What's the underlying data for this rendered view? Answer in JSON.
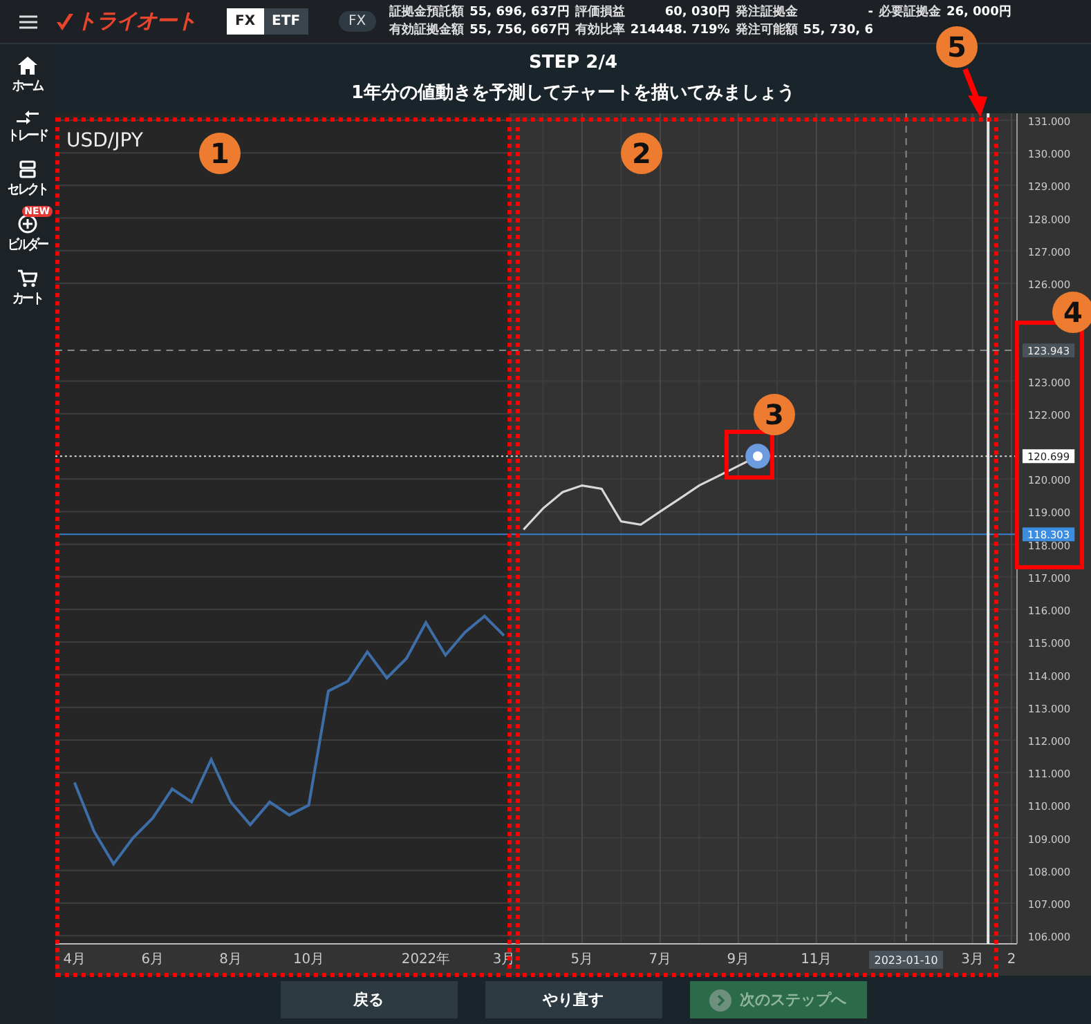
{
  "header": {
    "logo": "トライオート",
    "tabs": [
      {
        "label": "FX",
        "selected": true
      },
      {
        "label": "ETF",
        "selected": false
      }
    ],
    "market_badge": "FX",
    "stats": [
      {
        "label": "証拠金預託額",
        "value": "55, 696, 637円"
      },
      {
        "label": "評価損益",
        "value": "60, 030円"
      },
      {
        "label": "発注証拠金",
        "value": "-"
      },
      {
        "label": "必要証拠金",
        "value": "26, 000円"
      },
      {
        "label": "有効証拠金額",
        "value": "55, 756, 667円"
      },
      {
        "label": "有効比率",
        "value": "214448. 719%"
      },
      {
        "label": "発注可能額",
        "value": "55, 730, 6"
      }
    ]
  },
  "sidebar": {
    "items": [
      {
        "label": "ホーム",
        "kind": "home"
      },
      {
        "label": "トレード",
        "kind": "trade"
      },
      {
        "label": "セレクト",
        "kind": "select"
      },
      {
        "label": "ビルダー",
        "kind": "builder",
        "badge": "NEW"
      },
      {
        "label": "カート",
        "kind": "cart"
      }
    ]
  },
  "step": {
    "title": "STEP 2/4",
    "subtitle": "1年分の値動きを予測してチャートを描いてみましょう"
  },
  "chart": {
    "symbol": "USD/JPY",
    "crosshair_label": "2023-01-10",
    "chart_data": {
      "type": "line",
      "categories": [
        "4月",
        null,
        null,
        null,
        "6月",
        null,
        null,
        null,
        "8月",
        null,
        null,
        null,
        "10月",
        null,
        null,
        null,
        null,
        null,
        "2022年",
        null,
        null,
        null,
        "3月",
        null,
        null,
        null,
        "5月",
        null,
        null,
        null,
        "7月",
        null,
        null,
        null,
        "9月",
        null,
        null,
        null,
        "11月",
        null,
        null,
        null,
        null,
        null,
        null,
        null,
        "3月",
        null,
        "2",
        null
      ],
      "series": [
        {
          "color": "#3d6ea8",
          "values": [
            110.7,
            109.2,
            108.2,
            109.0,
            109.6,
            110.5,
            110.1,
            111.4,
            110.1,
            109.4,
            110.1,
            109.7,
            110.0,
            113.5,
            113.8,
            114.7,
            113.9,
            114.5,
            115.6,
            114.6,
            115.3,
            115.8,
            115.2,
            null,
            null,
            null,
            null,
            null,
            null,
            null,
            null,
            null,
            null,
            null,
            null,
            null,
            null,
            null,
            null,
            null,
            null,
            null,
            null,
            null,
            null,
            null,
            null,
            null,
            null,
            null
          ]
        },
        {
          "color": "#d8d8d8",
          "values": [
            null,
            null,
            null,
            null,
            null,
            null,
            null,
            null,
            null,
            null,
            null,
            null,
            null,
            null,
            null,
            null,
            null,
            null,
            null,
            null,
            null,
            null,
            null,
            118.45,
            119.1,
            119.6,
            119.8,
            119.7,
            118.7,
            118.6,
            119.0,
            119.4,
            119.8,
            120.1,
            120.4,
            120.7,
            null,
            null,
            null,
            null,
            null,
            null,
            null,
            null,
            null,
            null,
            null,
            null,
            null,
            null
          ]
        }
      ],
      "ylim": [
        105.75,
        131.21
      ],
      "grid": true,
      "yticks": [
        {
          "value": 106,
          "label": "106.000"
        },
        {
          "value": 107,
          "label": "107.000"
        },
        {
          "value": 108,
          "label": "108.000"
        },
        {
          "value": 109,
          "label": "109.000"
        },
        {
          "value": 110,
          "label": "110.000"
        },
        {
          "value": 111,
          "label": "111.000"
        },
        {
          "value": 112,
          "label": "112.000"
        },
        {
          "value": 113,
          "label": "113.000"
        },
        {
          "value": 114,
          "label": "114.000"
        },
        {
          "value": 115,
          "label": "115.000"
        },
        {
          "value": 116,
          "label": "116.000"
        },
        {
          "value": 117,
          "label": "117.000"
        },
        {
          "value": 118,
          "label": "118.000"
        },
        {
          "value": 119,
          "label": "119.000"
        },
        {
          "value": 120,
          "label": "120.000"
        },
        {
          "value": 122,
          "label": "122.000"
        },
        {
          "value": 123,
          "label": "123.000"
        },
        {
          "value": 126,
          "label": "126.000"
        },
        {
          "value": 127,
          "label": "127.000"
        },
        {
          "value": 128,
          "label": "128.000"
        },
        {
          "value": 129,
          "label": "129.000"
        },
        {
          "value": 130,
          "label": "130.000"
        },
        {
          "value": 131,
          "label": "131.000"
        }
      ],
      "ref_lines": [
        {
          "axis": "y",
          "value": 123.943,
          "label": "123.943"
        },
        {
          "axis": "y",
          "value": 120.699,
          "label": "120.699"
        },
        {
          "axis": "y",
          "value": 118.303,
          "label": "118.303"
        }
      ]
    }
  },
  "buttons": [
    {
      "label": "戻る",
      "disabled": false
    },
    {
      "label": "やり直す",
      "disabled": false
    },
    {
      "label": "次のステップへ",
      "disabled": true
    }
  ],
  "callouts": [
    {
      "label": "1",
      "kind": "region"
    },
    {
      "label": "2",
      "kind": "region"
    },
    {
      "label": "3",
      "kind": "marker"
    },
    {
      "label": "4",
      "kind": "marker"
    },
    {
      "label": "5",
      "kind": "arrow"
    }
  ]
}
